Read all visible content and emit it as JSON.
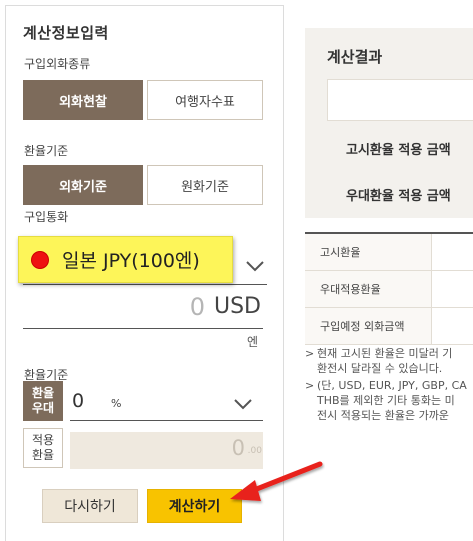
{
  "left": {
    "title": "계산정보입력",
    "purchase_type": {
      "label": "구입외화종류",
      "options": [
        "외화현찰",
        "여행자수표"
      ],
      "selected_index": 0
    },
    "rate_basis": {
      "label": "환율기준",
      "options": [
        "외화기준",
        "원화기준"
      ],
      "selected_index": 0
    },
    "currency": {
      "label": "구입통화",
      "selected": "일본 JPY(100엔)"
    },
    "amount": {
      "value": "0",
      "unit": "USD",
      "sub_unit": "엔"
    },
    "preferential": {
      "label": "환율기준",
      "preferential_rate_label": [
        "환율",
        "우대"
      ],
      "preferential_value": "0",
      "preferential_unit": "%",
      "applied_rate_label": [
        "적용",
        "환율"
      ],
      "applied_value": "0",
      "applied_decimal": ".00"
    },
    "buttons": {
      "reset": "다시하기",
      "calculate": "계산하기"
    }
  },
  "result": {
    "title": "계산결과",
    "items": [
      "고시환율 적용 금액",
      "우대환율 적용 금액"
    ]
  },
  "table": {
    "rows": [
      "고시환율",
      "우대적용환율",
      "구입예정 외화금액"
    ]
  },
  "notes": [
    {
      "mark": ">",
      "lines": [
        "현재 고시된 환율은 미달러 기",
        "환전시 달라질 수 있습니다."
      ]
    },
    {
      "mark": ">",
      "lines": [
        "(단, USD, EUR, JPY, GBP, CA",
        "THB를 제외한 기타 통화는 미",
        "전시 적용되는 환율은 가까운"
      ]
    }
  ],
  "colors": {
    "active_brown": "#7d6b5b",
    "calc_button_yellow": "#f8c300",
    "callout_yellow": "#fdf559",
    "marker_red": "#ee1111",
    "arrow_red": "#e8211c"
  }
}
